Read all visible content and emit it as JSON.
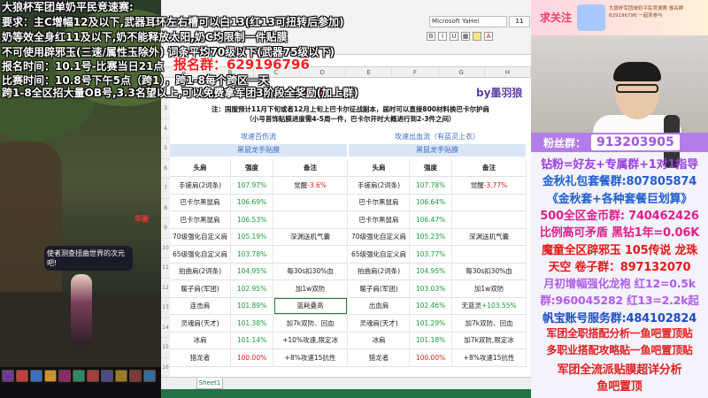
{
  "overlay": {
    "line1": "大狼杯军团单奶平民竞速赛:",
    "line2": "要求：主C增幅12及以下,武器耳环左右槽可以白13(红13可扭转后参加)",
    "line3": "奶等效全身红11及以下,奶不能释放太阳,奶C均限制一件贴膜",
    "line4": "不可使用辟邪玉(三速/属性玉除外)  词条平均70级以下(武器75级以下)",
    "line5": "报名时间：10.1号-比赛当日21点",
    "signup_group": "报名群：629196796",
    "line6": "比赛时间：10.8号下午5点（跨1），跨1-8每个跨区一天",
    "line7": "跨1-8全区招大量OB号,3.3名望以上,可以免费拿军团3阶段全奖励(加上群)",
    "game_char_name": "华丽",
    "chat_bubble": "使者测查扭曲世界的次元吧!"
  },
  "excel": {
    "font_name": "Microsoft YaHei",
    "font_size": "11",
    "title": "度分析",
    "author": "by墨羽狼",
    "notice_line1": "注：国服预计11月下旬或者12月上旬上巴卡尔征战副本，届时可以直接800材料换巴卡尔护肩",
    "notice_line2": "（小号首饰贴膜进度需4-5周一件，巴卡尔开时大概进行到2-3件之间）",
    "left_section": "攻速百伤流",
    "right_section": "攻速出血流（有蓝灵上衣）",
    "left_group": "黑鼠龙手贴膜",
    "right_group": "黑鼠龙手贴膜",
    "headers": [
      "头肩",
      "强度",
      "备注"
    ],
    "left_rows": [
      {
        "name": "手搓肩(2词条)",
        "pct": "107.97%",
        "note_prefix": "觉醒",
        "note_neg": "-3.6%",
        "note": ""
      },
      {
        "name": "巴卡尔黑鼠肩",
        "pct": "106.69%",
        "note": ""
      },
      {
        "name": "巴卡尔黑鼠肩",
        "pct": "106.53%",
        "note": ""
      },
      {
        "name": "70级强化自定义肩",
        "pct": "105.19%",
        "note": "深渊送机气囊"
      },
      {
        "name": "65级强化自定义肩",
        "pct": "103.78%",
        "note": ""
      },
      {
        "name": "拍曲肩(2词条)",
        "pct": "104.95%",
        "note": "每30s扣30%血"
      },
      {
        "name": "暖子肩(军团)",
        "pct": "102.95%",
        "note": "加1w双防"
      },
      {
        "name": "连击肩",
        "pct": "101.89%",
        "note": "蓝耗叠高"
      },
      {
        "name": "灵魂肩(天才)",
        "pct": "101.38%",
        "note": "加7k双防、回血"
      },
      {
        "name": "冰肩",
        "pct": "101.14%",
        "note": "+10%攻速,限定冰"
      },
      {
        "name": "猎龙者",
        "pct": "100.00%",
        "note": "+8%攻速15抗性"
      }
    ],
    "right_rows": [
      {
        "name": "手搓肩(2词条)",
        "pct": "107.78%",
        "note_prefix": "觉醒",
        "note_neg": "-3.77%"
      },
      {
        "name": "巴卡尔黑鼠肩",
        "pct": "106.64%",
        "note": ""
      },
      {
        "name": "巴卡尔黑鼠肩",
        "pct": "106.47%",
        "note": ""
      },
      {
        "name": "70级强化自定义肩",
        "pct": "105.23%",
        "note": "深渊送机气囊"
      },
      {
        "name": "65级强化自定义肩",
        "pct": "103.77%",
        "note": ""
      },
      {
        "name": "拍曲肩(2词条)",
        "pct": "104.95%",
        "note": "每30s扣30%血"
      },
      {
        "name": "暖子肩(军团)",
        "pct": "103.03%",
        "note": "加1w双防"
      },
      {
        "name": "出血肩",
        "pct": "102.46%",
        "note_prefix": "无蓝灵",
        "note_pos": "+103.55%"
      },
      {
        "name": "灵魂肩(天才)",
        "pct": "101.29%",
        "note": "加7k双防、回血"
      },
      {
        "name": "冰肩",
        "pct": "101.18%",
        "note": "加7k双防,限定冰"
      },
      {
        "name": "猎龙者",
        "pct": "100.00%",
        "note": "+8%攻速15抗性"
      }
    ],
    "sheet_tab": "Sheet1",
    "row_numbers": [
      "3",
      "4",
      "5",
      "6",
      "7",
      "8",
      "9",
      "10",
      "11",
      "12",
      "13",
      "14",
      "15",
      "16",
      "17"
    ]
  },
  "right_panel": {
    "follow": "求关注",
    "mini_text": "大狼杯军团单奶平民竞速赛 报名群 629196796 一起来参与",
    "fans_label": "粉丝群：",
    "fans_number": "913203905",
    "lines": [
      {
        "text": "钻粉=好友+专属群+1对1指导",
        "color": "#9b3fe0",
        "size": 13
      },
      {
        "text": "金秋礼包套餐群:807805874",
        "color": "#2060d0",
        "size": 13
      },
      {
        "text": "《金秋套+各种套餐巨划算》",
        "color": "#2060d0",
        "size": 13
      },
      {
        "text": "500全区金币群:  740462426",
        "color": "#e0208a",
        "size": 13
      },
      {
        "text": "比例高可矛盾  黑钻1年=0.06K",
        "color": "#e0208a",
        "size": 13
      },
      {
        "text": "魔童全区辟邪玉 105传说 龙珠",
        "color": "#e81818",
        "size": 13
      },
      {
        "text": "天空 卷子群：897132070",
        "color": "#e81818",
        "size": 13
      },
      {
        "text": "月初增幅强化龙袍 红12=0.5k",
        "color": "#b05ce8",
        "size": 12.5
      },
      {
        "text": "群:960045282    红13=2.2k起",
        "color": "#b05ce8",
        "size": 12.5
      },
      {
        "text": "帆宝账号服务群:484102824",
        "color": "#1b4fc8",
        "size": 13
      },
      {
        "text": "军团全职搭配分析一鱼吧置顶贴",
        "color": "#e02020",
        "size": 12
      },
      {
        "text": "多职业搭配攻略贴一鱼吧置顶贴",
        "color": "#e02020",
        "size": 12
      },
      {
        "text": "军团全流派贴膜超详分析",
        "color": "#e02020",
        "size": 13
      },
      {
        "text": "鱼吧置顶",
        "color": "#e02020",
        "size": 13
      }
    ]
  }
}
